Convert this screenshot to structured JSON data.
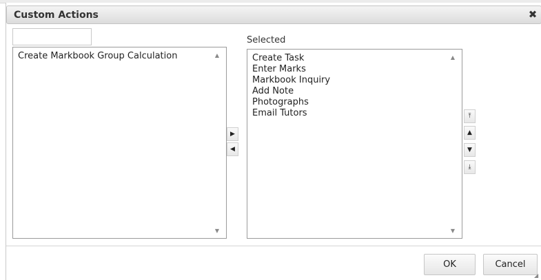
{
  "dialog": {
    "title": "Custom Actions",
    "close_glyph": "✖",
    "close_icon": "close-icon"
  },
  "available": {
    "filter_value": "",
    "filter_placeholder": "",
    "items": [
      "Create Markbook Group Calculation"
    ]
  },
  "selected": {
    "label": "Selected",
    "items": [
      "Create Task",
      "Enter Marks",
      "Markbook Inquiry",
      "Add Note",
      "Photographs",
      "Email Tutors"
    ]
  },
  "transfer": {
    "add_glyph": "▶",
    "remove_glyph": "◀"
  },
  "reorder": {
    "top_glyph": "⤒",
    "up_glyph": "▲",
    "down_glyph": "▼",
    "bottom_glyph": "⤓"
  },
  "scroll": {
    "up_glyph": "▲",
    "down_glyph": "▼"
  },
  "footer": {
    "ok_label": "OK",
    "cancel_label": "Cancel"
  }
}
